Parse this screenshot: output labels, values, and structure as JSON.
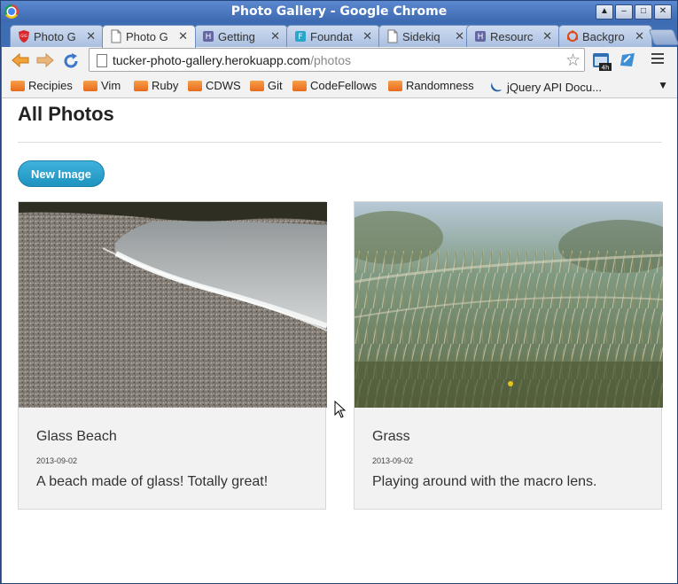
{
  "window": {
    "title": "Photo Gallery - Google Chrome",
    "controls": [
      "▲",
      "–",
      "□",
      "✕"
    ]
  },
  "tabs": [
    {
      "label": "Photo G",
      "icon": "red-badge-icon",
      "active": false
    },
    {
      "label": "Photo G",
      "icon": "page-icon",
      "active": true
    },
    {
      "label": "Getting",
      "icon": "heroku-icon",
      "active": false
    },
    {
      "label": "Foundat",
      "icon": "foundation-icon",
      "active": false
    },
    {
      "label": "Sidekiq",
      "icon": "page-icon",
      "active": false
    },
    {
      "label": "Resourc",
      "icon": "heroku-icon",
      "active": false
    },
    {
      "label": "Backgro",
      "icon": "ubuntu-icon",
      "active": false
    }
  ],
  "toolbar": {
    "url_host": "tucker-photo-gallery.herokuapp.com",
    "url_path": "/photos",
    "ext_badge": "4h"
  },
  "bookmarks": [
    {
      "label": "Recipies"
    },
    {
      "label": "Vim"
    },
    {
      "label": "Ruby"
    },
    {
      "label": "CDWS"
    },
    {
      "label": "Git"
    },
    {
      "label": "CodeFellows"
    },
    {
      "label": "Randomness"
    },
    {
      "label": "jQuery API Docu...",
      "icon": "jquery-icon"
    }
  ],
  "page": {
    "heading": "All Photos",
    "new_button": "New Image",
    "photos": [
      {
        "title": "Glass Beach",
        "date": "2013-09-02",
        "description": "A beach made of glass! Totally great!"
      },
      {
        "title": "Grass",
        "date": "2013-09-02",
        "description": "Playing around with the macro lens."
      }
    ]
  },
  "colors": {
    "titlebar": "#3c69b0",
    "button": "#1f93c1",
    "card_bg": "#f2f2f2"
  }
}
